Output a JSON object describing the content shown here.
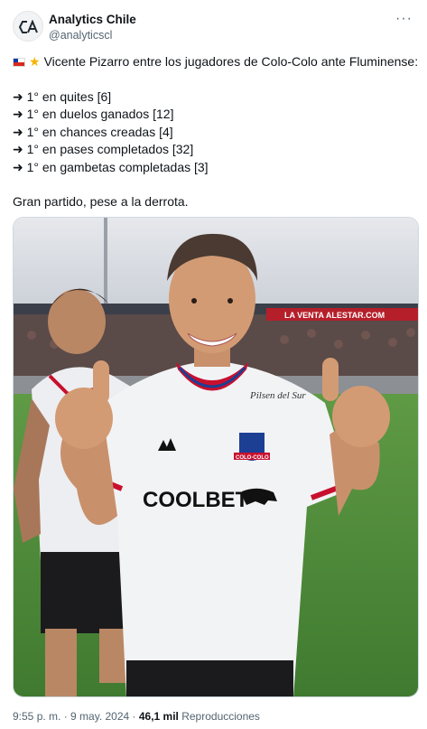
{
  "account": {
    "name": "Analytics Chile",
    "handle": "@analyticscl",
    "logo_icon": "ca-monogram-icon"
  },
  "menu_icon": "more-options-icon",
  "tweet": {
    "intro": "Vicente Pizarro entre los jugadores de Colo-Colo ante Fluminense:",
    "intro_icons": [
      "chile-flag-icon",
      "star-icon"
    ],
    "stats": [
      "➜ 1° en quites [6]",
      "➜ 1° en duelos ganados [12]",
      "➜ 1° en chances creadas [4]",
      "➜ 1° en pases completados [32]",
      "➜ 1° en gambetas completadas [3]"
    ],
    "closing": "Gran partido, pese a la derrota."
  },
  "photo": {
    "banner_text": "LA VENTA ALESTAR.COM",
    "shirt_sponsor": "COOLBET",
    "chest_text": "Pilsen del Sur",
    "badge_text": "COLO-COLO",
    "colors": {
      "shirt": "#f2f3f5",
      "collar_red": "#c8102e",
      "collar_blue": "#1c3f94",
      "grass": "#4f8a3a",
      "sky": "#dfe3e8"
    }
  },
  "meta": {
    "time_date": "9:55 p. m. · 9 may. 2024 · ",
    "views_count": "46,1 mil",
    "views_label": " Reproducciones"
  }
}
